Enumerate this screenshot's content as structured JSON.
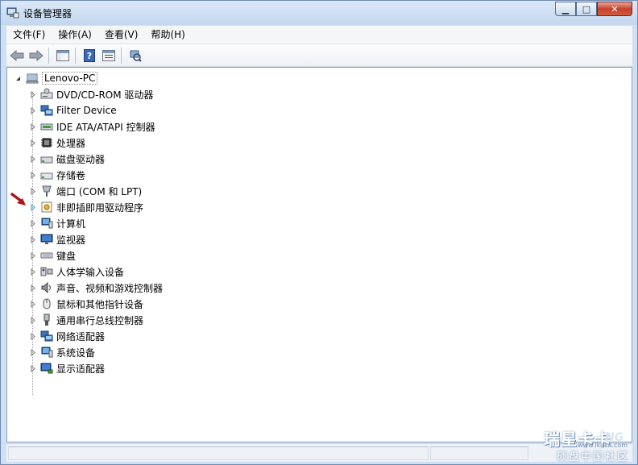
{
  "window": {
    "title": "设备管理器"
  },
  "menu": [
    "文件(F)",
    "操作(A)",
    "查看(V)",
    "帮助(H)"
  ],
  "tree": {
    "root": "Lenovo-PC",
    "items": [
      {
        "label": "DVD/CD-ROM 驱动器",
        "icon": "dvd-drive-icon"
      },
      {
        "label": "Filter Device",
        "icon": "network-device-icon"
      },
      {
        "label": "IDE ATA/ATAPI 控制器",
        "icon": "ide-controller-icon"
      },
      {
        "label": "处理器",
        "icon": "processor-icon"
      },
      {
        "label": "磁盘驱动器",
        "icon": "disk-drive-icon"
      },
      {
        "label": "存储卷",
        "icon": "storage-volume-icon"
      },
      {
        "label": "端口 (COM 和 LPT)",
        "icon": "port-icon"
      },
      {
        "label": "非即插即用驱动程序",
        "icon": "non-pnp-driver-icon"
      },
      {
        "label": "计算机",
        "icon": "computer-icon"
      },
      {
        "label": "监视器",
        "icon": "monitor-icon"
      },
      {
        "label": "键盘",
        "icon": "keyboard-icon"
      },
      {
        "label": "人体学输入设备",
        "icon": "hid-icon"
      },
      {
        "label": "声音、视频和游戏控制器",
        "icon": "sound-icon"
      },
      {
        "label": "鼠标和其他指针设备",
        "icon": "mouse-icon"
      },
      {
        "label": "通用串行总线控制器",
        "icon": "usb-icon"
      },
      {
        "label": "网络适配器",
        "icon": "network-adapter-icon"
      },
      {
        "label": "系统设备",
        "icon": "system-device-icon"
      },
      {
        "label": "显示适配器",
        "icon": "display-adapter-icon"
      }
    ]
  },
  "watermark": {
    "line1": "瑞星卡卡",
    "line2": "www.ikaka.com",
    "line3": "硕盘中国社区",
    "line4": "NG"
  }
}
